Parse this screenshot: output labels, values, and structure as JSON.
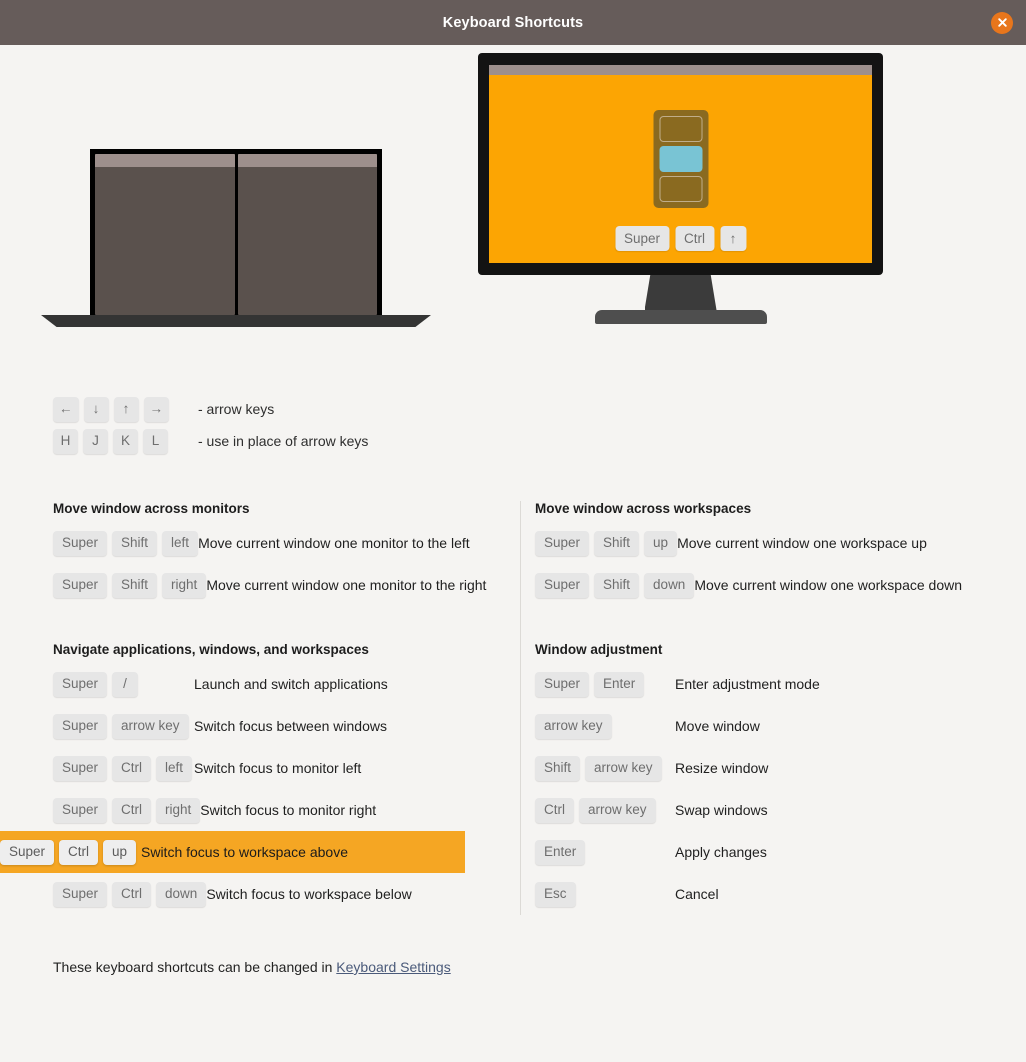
{
  "window": {
    "title": "Keyboard Shortcuts",
    "close_icon": "close-icon",
    "titlebar_color": "#665c5a",
    "close_button_color": "#e8761c",
    "background_color": "#f5f4f2"
  },
  "illustration": {
    "laptop": {
      "panes": 2,
      "pane_color": "#5a514d",
      "pane_titlebar_color": "#9d8f8c",
      "bezel_color": "#000000",
      "base_color": "#343434"
    },
    "monitor": {
      "screen_color": "#fca503",
      "bezel_color": "#131313",
      "screen_titlebar_color": "#9d8f8c",
      "workspace_stack_color": "#8a6a20",
      "active_workspace_color": "#79c4d4",
      "workspaces": [
        {
          "label": "",
          "active": false
        },
        {
          "label": "",
          "active": true
        },
        {
          "label": "",
          "active": false
        }
      ],
      "keys": [
        "Super",
        "Ctrl",
        "↑"
      ],
      "stand_neck_color": "#3b3b3b",
      "stand_base_color": "#4e4e4e"
    }
  },
  "legend": [
    {
      "keys": [
        "←",
        "↓",
        "↑",
        "→"
      ],
      "desc": "- arrow keys"
    },
    {
      "keys": [
        "H",
        "J",
        "K",
        "L"
      ],
      "desc": "- use in place of arrow keys"
    }
  ],
  "columns": {
    "left": [
      {
        "title": "Move window across monitors",
        "rows": [
          {
            "keys": [
              "Super",
              "Shift",
              "left"
            ],
            "desc": "Move current window one monitor to the left",
            "highlighted": false
          },
          {
            "keys": [
              "Super",
              "Shift",
              "right"
            ],
            "desc": "Move current window one monitor to the right",
            "highlighted": false
          }
        ]
      },
      {
        "title": "Navigate applications, windows, and workspaces",
        "rows": [
          {
            "keys": [
              "Super",
              "/"
            ],
            "desc": "Launch and switch applications",
            "highlighted": false
          },
          {
            "keys": [
              "Super",
              "arrow key"
            ],
            "desc": "Switch focus between windows",
            "highlighted": false
          },
          {
            "keys": [
              "Super",
              "Ctrl",
              "left"
            ],
            "desc": "Switch focus to monitor left",
            "highlighted": false
          },
          {
            "keys": [
              "Super",
              "Ctrl",
              "right"
            ],
            "desc": "Switch focus to monitor right",
            "highlighted": false
          },
          {
            "keys": [
              "Super",
              "Ctrl",
              "up"
            ],
            "desc": "Switch focus to workspace above",
            "highlighted": true
          },
          {
            "keys": [
              "Super",
              "Ctrl",
              "down"
            ],
            "desc": "Switch focus to workspace below",
            "highlighted": false
          }
        ]
      }
    ],
    "right": [
      {
        "title": "Move window across workspaces",
        "rows": [
          {
            "keys": [
              "Super",
              "Shift",
              "up"
            ],
            "desc": "Move current window one workspace up",
            "highlighted": false
          },
          {
            "keys": [
              "Super",
              "Shift",
              "down"
            ],
            "desc": "Move current window one workspace down",
            "highlighted": false
          }
        ]
      },
      {
        "title": "Window adjustment",
        "rows": [
          {
            "keys": [
              "Super",
              "Enter"
            ],
            "desc": "Enter adjustment mode",
            "highlighted": false
          },
          {
            "keys": [
              "arrow key"
            ],
            "desc": "Move window",
            "highlighted": false
          },
          {
            "keys": [
              "Shift",
              "arrow key"
            ],
            "desc": "Resize window",
            "highlighted": false
          },
          {
            "keys": [
              "Ctrl",
              "arrow key"
            ],
            "desc": "Swap windows",
            "highlighted": false
          },
          {
            "keys": [
              "Enter"
            ],
            "desc": "Apply changes",
            "highlighted": false
          },
          {
            "keys": [
              "Esc"
            ],
            "desc": "Cancel",
            "highlighted": false
          }
        ]
      }
    ]
  },
  "footer": {
    "text": "These keyboard shortcuts can be changed in ",
    "link_label": "Keyboard Settings",
    "link_color": "#4a5a7a"
  },
  "highlight_color": "#f5a623"
}
